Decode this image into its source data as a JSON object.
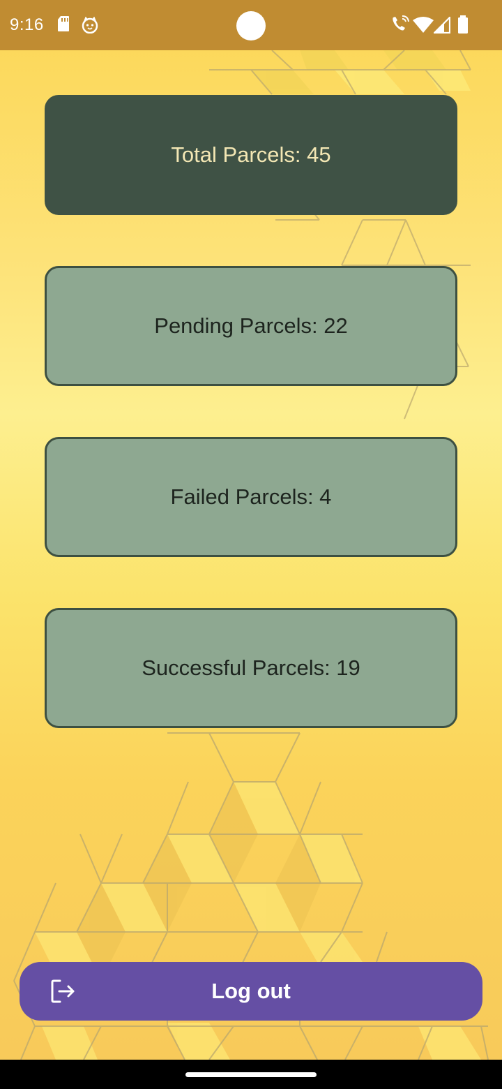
{
  "status_bar": {
    "time": "9:16",
    "background": "#c08c32",
    "icons": [
      "sd-card-icon",
      "cat-notification-icon",
      "wifi-calling-icon",
      "wifi-icon",
      "cellular-signal-icon",
      "battery-icon"
    ]
  },
  "cards": {
    "total": {
      "label": "Total Parcels: 45",
      "color": "#3f5245"
    },
    "pending": {
      "label": "Pending Parcels: 22",
      "color": "#8ea891"
    },
    "failed": {
      "label": "Failed Parcels: 4",
      "color": "#8ea891"
    },
    "successful": {
      "label": "Successful Parcels: 19",
      "color": "#8ea891"
    }
  },
  "logout": {
    "label": "Log out",
    "icon": "logout-icon",
    "color": "#654fa4"
  }
}
